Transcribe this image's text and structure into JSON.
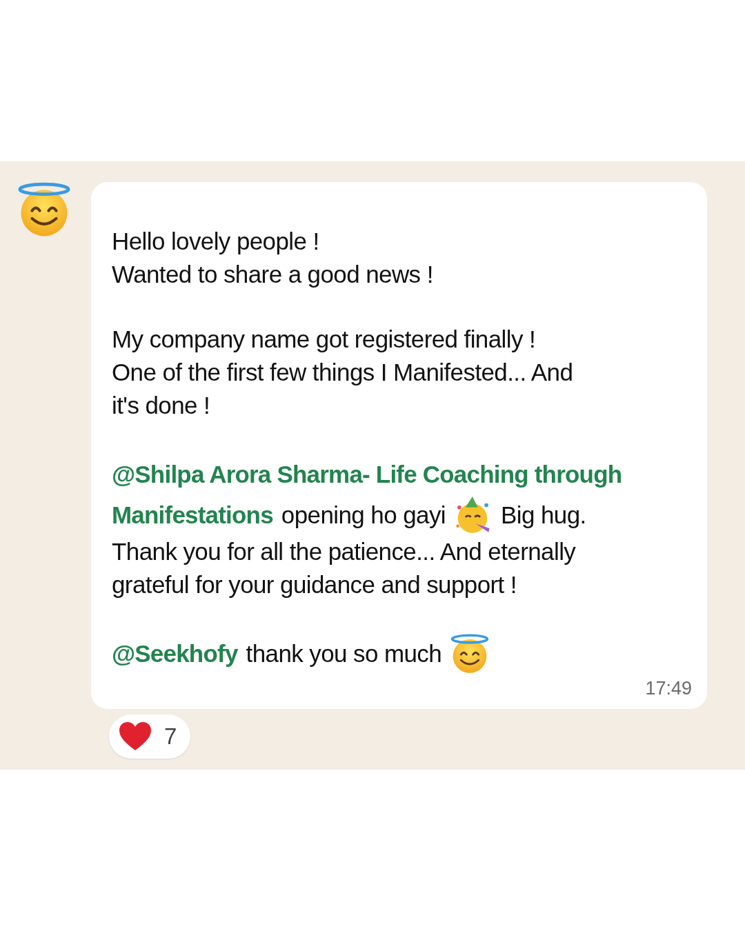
{
  "sender": {
    "avatar": {
      "kind": "halo"
    }
  },
  "message": {
    "paragraphs": [
      [
        [
          {
            "kind": "text",
            "text": "Hello lovely people !"
          }
        ],
        [
          {
            "kind": "text",
            "text": "Wanted to share a good news !"
          }
        ]
      ],
      [
        [
          {
            "kind": "text",
            "text": "My company name got registered finally !"
          }
        ],
        [
          {
            "kind": "text",
            "text": "One of the first few things I Manifested... And"
          }
        ],
        [
          {
            "kind": "text",
            "text": "it's done !"
          }
        ]
      ],
      [
        [
          {
            "kind": "mention",
            "text": "@Shilpa Arora Sharma- Life Coaching through"
          }
        ],
        [
          {
            "kind": "mention",
            "text": "Manifestations"
          },
          {
            "kind": "text",
            "text": "opening ho gayi"
          },
          {
            "kind": "party"
          },
          {
            "kind": "text",
            "text": "Big hug."
          }
        ],
        [
          {
            "kind": "text",
            "text": "Thank you for all the patience... And eternally"
          }
        ],
        [
          {
            "kind": "text",
            "text": "grateful for your guidance and support !"
          }
        ]
      ],
      [
        [
          {
            "kind": "mention",
            "text": "@Seekhofy"
          },
          {
            "kind": "text",
            "text": "thank you so much"
          },
          {
            "kind": "halo"
          }
        ]
      ]
    ],
    "time": "17:49"
  },
  "reaction": {
    "kind": "heart",
    "count": "7"
  }
}
